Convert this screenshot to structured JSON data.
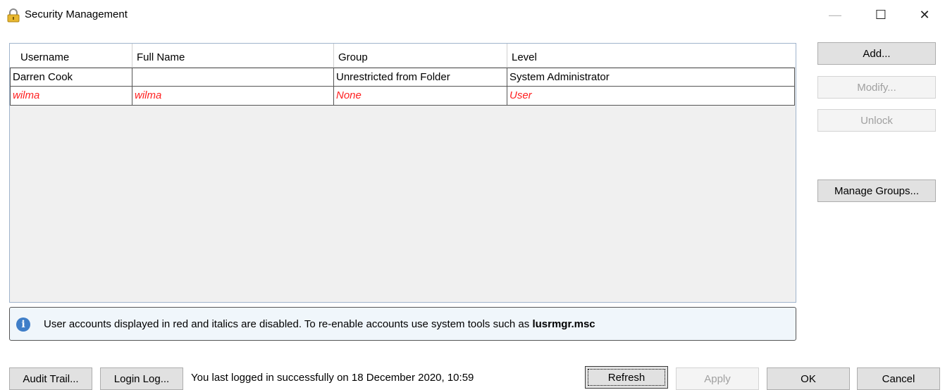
{
  "window": {
    "title": "Security Management",
    "minimize_glyph": "—",
    "maximize_glyph": "☐",
    "close_glyph": "✕"
  },
  "grid": {
    "columns": [
      "Username",
      "Full Name",
      "Group",
      "Level"
    ],
    "rows": [
      {
        "username": "Darren Cook",
        "full_name": "",
        "group": "Unrestricted from Folder",
        "level": "System Administrator",
        "disabled": false
      },
      {
        "username": "wilma",
        "full_name": "wilma",
        "group": "None",
        "level": "User",
        "disabled": true
      }
    ]
  },
  "side_buttons": {
    "add": "Add...",
    "modify": "Modify...",
    "unlock": "Unlock",
    "manage_groups": "Manage Groups..."
  },
  "info": {
    "icon": "info-icon",
    "text": "User accounts displayed in red and italics are disabled. To re-enable accounts use system tools such as ",
    "tool": "lusrmgr.msc"
  },
  "footer": {
    "audit_trail": "Audit Trail...",
    "login_log": "Login Log...",
    "status": "You last logged in successfully on 18 December 2020, 10:59",
    "refresh": "Refresh",
    "apply": "Apply",
    "ok": "OK",
    "cancel": "Cancel"
  },
  "colors": {
    "disabled_row_text": "#ff2020",
    "info_background": "#f0f6fb",
    "info_icon": "#3f7ec8"
  }
}
